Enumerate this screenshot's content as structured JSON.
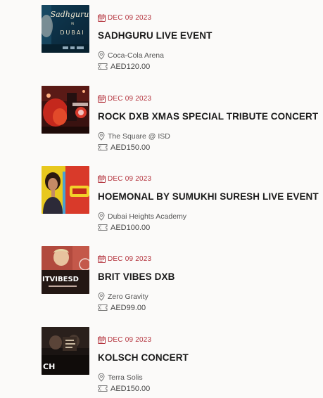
{
  "events": [
    {
      "date": "DEC 09 2023",
      "title": "SADHGURU LIVE EVENT",
      "venue": "Coca-Cola Arena",
      "price": "AED120.00",
      "thumb_text": [
        "Sadhguru",
        "IN",
        "DUBAI"
      ]
    },
    {
      "date": "DEC 09 2023",
      "title": "ROCK DXB XMAS SPECIAL TRIBUTE CONCERT",
      "venue": "The Square @ ISD",
      "price": "AED150.00"
    },
    {
      "date": "DEC 09 2023",
      "title": "HOEMONAL BY SUMUKHI SURESH LIVE EVENT",
      "venue": "Dubai Heights Academy",
      "price": "AED100.00"
    },
    {
      "date": "DEC 09 2023",
      "title": "BRIT VIBES DXB",
      "venue": "Zero Gravity",
      "price": "AED99.00",
      "thumb_text": [
        "ITVIBESD"
      ]
    },
    {
      "date": "DEC 09 2023",
      "title": "KOLSCH CONCERT",
      "venue": "Terra Solis",
      "price": "AED150.00",
      "thumb_text": [
        "CH"
      ]
    }
  ],
  "colors": {
    "date_accent": "#b4343e",
    "title": "#1b1b1b",
    "meta_text": "#555555",
    "background": "#fbfaf9"
  },
  "icons": {
    "date": "calendar-icon",
    "venue": "map-pin-icon",
    "price": "ticket-icon"
  }
}
